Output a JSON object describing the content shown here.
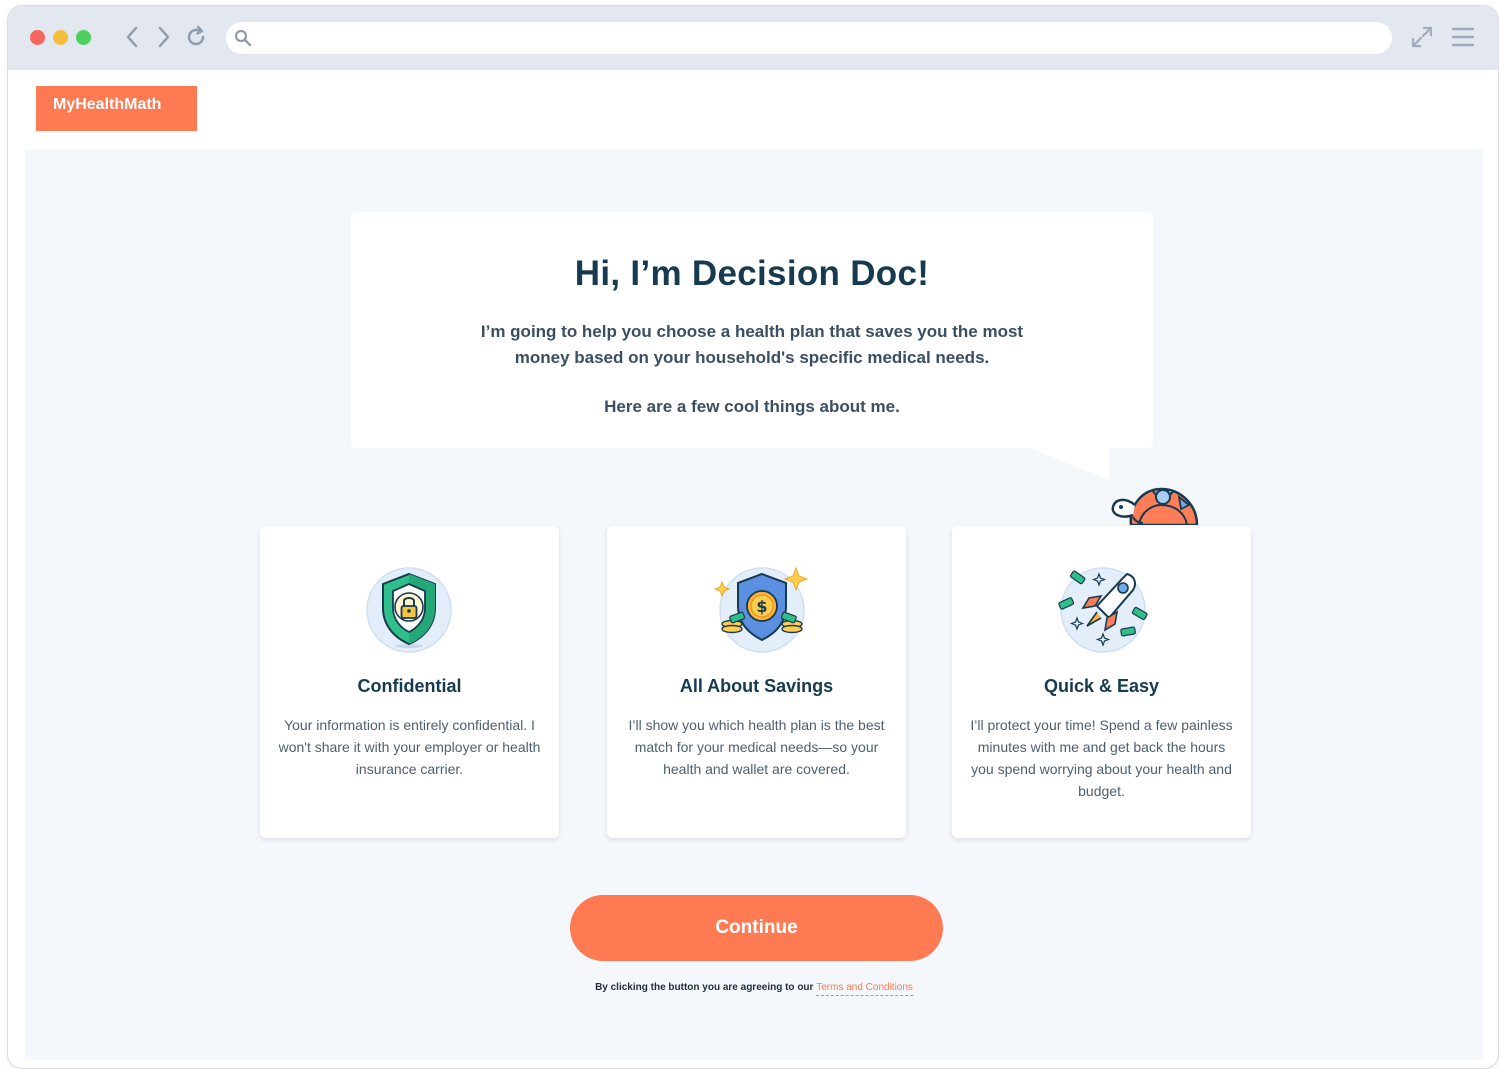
{
  "browser": {
    "url_value": "",
    "icons": {
      "back": "chevron-left-icon",
      "forward": "chevron-right-icon",
      "reload": "reload-icon",
      "search": "search-icon",
      "expand": "expand-icon",
      "menu": "hamburger-menu-icon"
    }
  },
  "brand": {
    "logo_text": "MyHealthMath",
    "accent_color": "#fd7a52",
    "heading_color": "#163a50"
  },
  "intro": {
    "greeting": "Hi, I’m Decision Doc!",
    "description": "I’m going to help you choose a health plan that saves you the most money based on your household's specific medical needs.",
    "cool_things": "Here are a few cool things about me."
  },
  "features": [
    {
      "icon": "shield-lock-icon",
      "title": "Confidential",
      "text": "Your information is entirely confidential. I won't share it with your employer or health insurance carrier."
    },
    {
      "icon": "shield-dollar-coins-icon",
      "title": "All About Savings",
      "text": "I’ll show you which health plan is the best match for your medical needs—so your health and wallet are covered."
    },
    {
      "icon": "rocket-money-icon",
      "title": "Quick & Easy",
      "text": "I’ll protect your time! Spend a few painless minutes with me and get back the hours you spend worrying about your health and budget."
    }
  ],
  "cta": {
    "continue_label": "Continue",
    "terms_prefix": "By clicking the button you are agreeing to our",
    "terms_link": "Terms and Conditions"
  }
}
